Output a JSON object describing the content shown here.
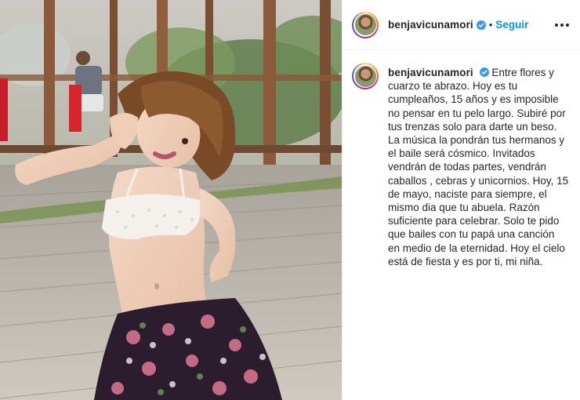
{
  "post": {
    "username": "benjavicunamori",
    "separator": "•",
    "follow_label": "Seguir",
    "caption": "Entre flores y cuarzo te abrazo. Hoy es tu cumpleaños, 15 años y es imposible no pensar en tu pelo largo. Subiré por tus trenzas solo para darte un beso. La música la pondrán tus hermanos y el baile será cósmico. Invitados vendrán de todas partes, vendrán caballos , cebras y unicornios. Hoy, 15 de mayo, naciste para siempre, el mismo dia que tu abuela. Razón suficiente para celebrar. Solo te pido que bailes con tu papá una canción en medio de la eternidad. Hoy el cielo está de fiesta y es por ti, mi niña."
  },
  "icons": {
    "verified": "verified-badge-icon",
    "more": "more-options-icon"
  },
  "colors": {
    "link_blue": "#0095f6",
    "verified_blue": "#3897f0",
    "text": "#262626"
  }
}
